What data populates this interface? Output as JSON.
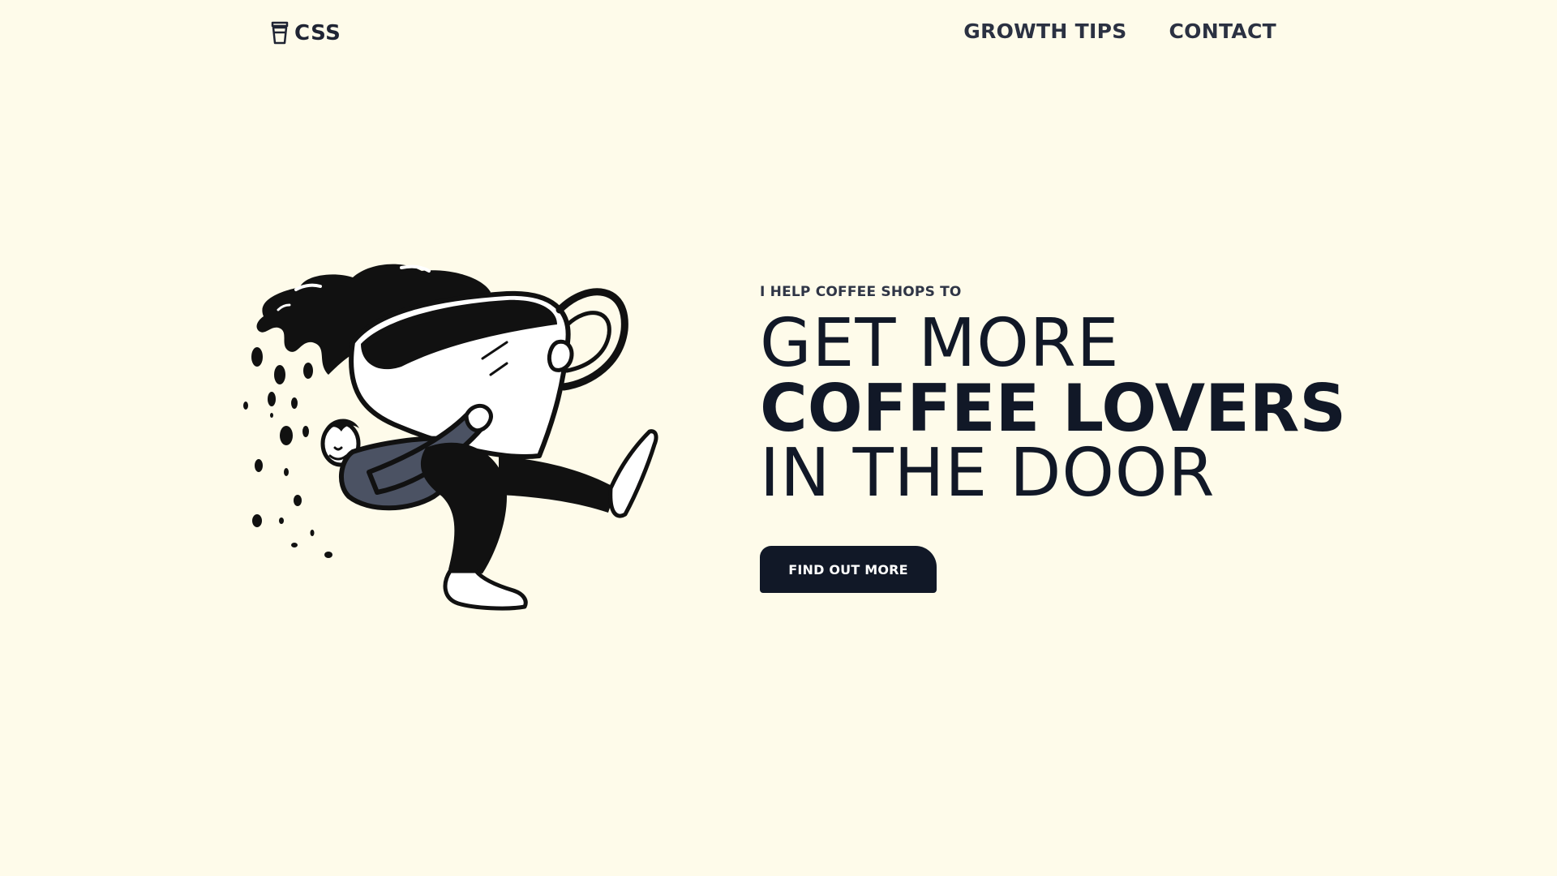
{
  "brand": {
    "name": "CSS",
    "icon": "coffee-cup-icon"
  },
  "nav": {
    "items": [
      {
        "label": "GROWTH TIPS"
      },
      {
        "label": "CONTACT"
      }
    ]
  },
  "hero": {
    "eyebrow": "I HELP COFFEE SHOPS TO",
    "headline": {
      "line1": "GET MORE",
      "line2": "COFFEE LOVERS",
      "line3": "IN THE DOOR"
    },
    "cta_label": "FIND OUT MORE",
    "illustration": "person-carrying-giant-coffee-cup-illustration"
  },
  "colors": {
    "background": "#FEFBEA",
    "text": "#111827",
    "button_bg": "#111827",
    "button_text": "#FFFFFF"
  }
}
